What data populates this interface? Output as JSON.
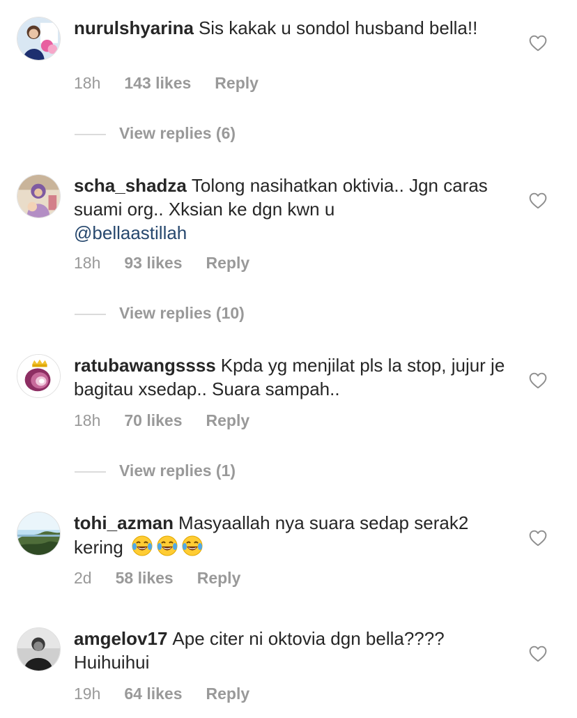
{
  "comments": [
    {
      "username": "nurulshyarina",
      "text": "Sis kakak u sondol husband bella!!",
      "mention": "",
      "time": "18h",
      "likes": "143 likes",
      "reply": "Reply",
      "view_replies": "View replies (6)"
    },
    {
      "username": "scha_shadza",
      "text": "Tolong nasihatkan oktivia.. Jgn caras suami org.. Xksian ke dgn kwn u",
      "mention": "@bellaastillah",
      "time": "18h",
      "likes": "93 likes",
      "reply": "Reply",
      "view_replies": "View replies (10)"
    },
    {
      "username": "ratubawangssss",
      "text": "Kpda yg menjilat pls la stop, jujur je bagitau xsedap.. Suara sampah..",
      "mention": "",
      "time": "18h",
      "likes": "70 likes",
      "reply": "Reply",
      "view_replies": "View replies (1)"
    },
    {
      "username": "tohi_azman",
      "text": "Masyaallah nya suara sedap serak2 kering",
      "mention": "",
      "emoji": "face-with-tears-of-joy x3",
      "time": "2d",
      "likes": "58 likes",
      "reply": "Reply"
    },
    {
      "username": "amgelov17",
      "text": "Ape citer ni oktovia dgn bella???? Huihuihui",
      "mention": "",
      "time": "19h",
      "likes": "64 likes",
      "reply": "Reply"
    }
  ],
  "icons": {
    "like": "heart-outline-icon",
    "emoji": "laughing-tears-emoji"
  },
  "colors": {
    "text": "#262626",
    "meta": "#999999",
    "mention": "#27486e",
    "divider": "#dbdbdb"
  }
}
